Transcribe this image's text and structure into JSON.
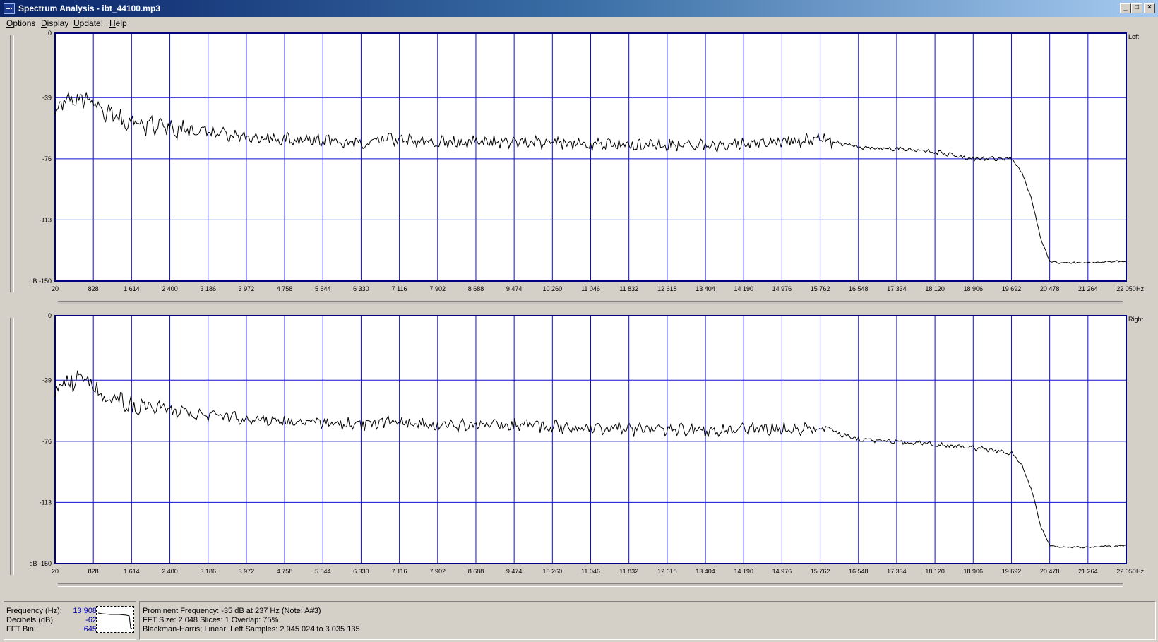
{
  "window": {
    "title": "Spectrum Analysis - ibt_44100.mp3",
    "buttons": {
      "minimize": "_",
      "maximize": "□",
      "close": "×"
    }
  },
  "menu": [
    {
      "accel": "O",
      "rest": "ptions"
    },
    {
      "accel": "D",
      "rest": "isplay"
    },
    {
      "accel": "U",
      "rest": "pdate!"
    },
    {
      "accel": "H",
      "rest": "elp"
    }
  ],
  "colors": {
    "grid": "#1010d0",
    "trace": "#000000",
    "plot_bg": "#ffffff",
    "axis": "#000080"
  },
  "x_ticks": [
    "20",
    "828",
    "1 614",
    "2 400",
    "3 186",
    "3 972",
    "4 758",
    "5 544",
    "6 330",
    "7 116",
    "7 902",
    "8 688",
    "9 474",
    "10 260",
    "11 046",
    "11 832",
    "12 618",
    "13 404",
    "14 190",
    "14 976",
    "15 762",
    "16 548",
    "17 334",
    "18 120",
    "18 906",
    "19 692",
    "20 478",
    "21 264",
    "22 050"
  ],
  "x_unit": "Hz",
  "y_ticks": [
    "0",
    "-39",
    "-76",
    "-113",
    "dB -150"
  ],
  "chart_data": [
    {
      "type": "line",
      "channel": "Left",
      "x_unit": "Hz",
      "y_unit": "dB",
      "xlim": [
        20,
        22050
      ],
      "ylim": [
        -150,
        0
      ],
      "grid": true,
      "x": [
        20,
        300,
        650,
        1000,
        1614,
        2400,
        3186,
        3972,
        4758,
        5544,
        6330,
        7116,
        7902,
        8688,
        9474,
        10260,
        11046,
        11832,
        12618,
        13404,
        14190,
        14976,
        15762,
        16548,
        17334,
        18120,
        18906,
        19500,
        19692,
        19900,
        20100,
        20300,
        20478,
        20700,
        21264,
        22050
      ],
      "y": [
        -46,
        -39,
        -40,
        -47,
        -55,
        -57,
        -60,
        -63,
        -64,
        -65,
        -66,
        -64,
        -66,
        -66,
        -66,
        -66,
        -68,
        -68,
        -68,
        -68,
        -67,
        -65,
        -64,
        -69,
        -70,
        -72,
        -76,
        -76,
        -76,
        -84,
        -100,
        -125,
        -138,
        -139,
        -139,
        -138
      ]
    },
    {
      "type": "line",
      "channel": "Right",
      "x_unit": "Hz",
      "y_unit": "dB",
      "xlim": [
        20,
        22050
      ],
      "ylim": [
        -150,
        0
      ],
      "grid": true,
      "x": [
        20,
        300,
        650,
        1000,
        1614,
        2400,
        3186,
        3972,
        4758,
        5544,
        6330,
        7116,
        7902,
        8688,
        9474,
        10260,
        11046,
        11832,
        12618,
        13404,
        14190,
        14976,
        15762,
        16548,
        17334,
        18120,
        18906,
        19500,
        19692,
        19900,
        20100,
        20300,
        20478,
        20700,
        21264,
        22050
      ],
      "y": [
        -46,
        -39,
        -40,
        -47,
        -55,
        -57,
        -60,
        -63,
        -64,
        -65,
        -66,
        -64,
        -66,
        -66,
        -66,
        -67,
        -68,
        -69,
        -69,
        -70,
        -69,
        -68,
        -68,
        -75,
        -76,
        -78,
        -80,
        -82,
        -83,
        -90,
        -105,
        -128,
        -139,
        -140,
        -140,
        -139
      ]
    }
  ],
  "status": {
    "frequency_label": "Frequency (Hz):",
    "frequency_value": "13 908",
    "decibels_label": "Decibels (dB):",
    "decibels_value": "-62",
    "fftbin_label": "FFT Bin:",
    "fftbin_value": "645",
    "line1": "Prominent Frequency: -35 dB at 237 Hz (Note: A#3)",
    "line2": "FFT Size: 2 048  Slices: 1  Overlap: 75%",
    "line3": "Blackman-Harris; Linear; Left  Samples: 2 945 024 to 3 035 135"
  }
}
